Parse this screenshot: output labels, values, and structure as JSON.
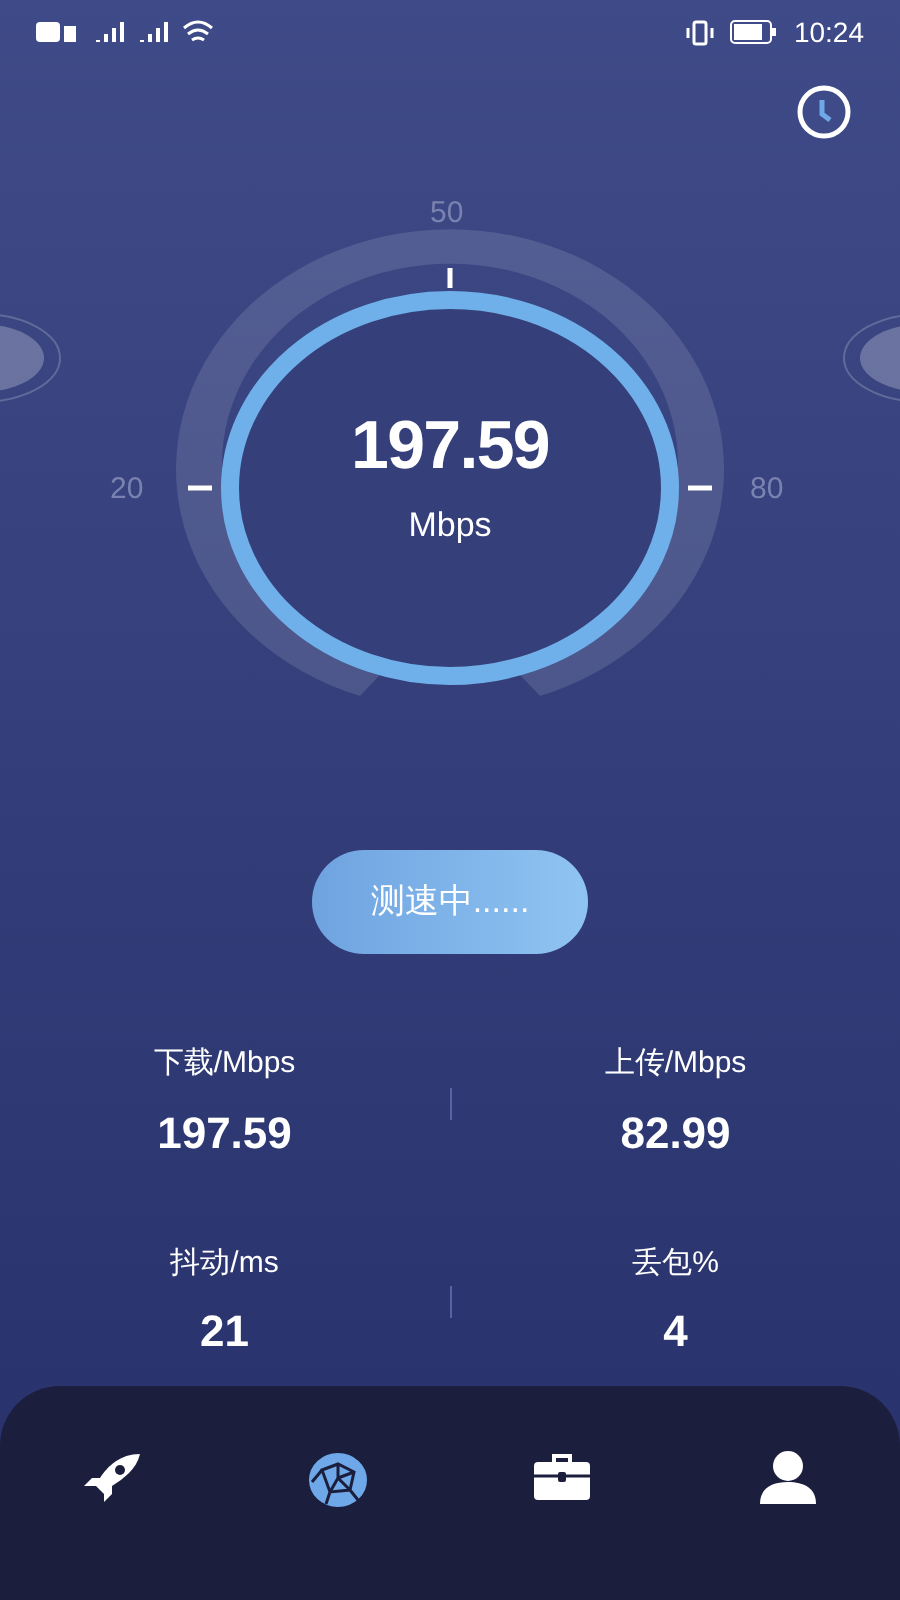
{
  "status_bar": {
    "time": "10:24"
  },
  "gauge": {
    "ticks": [
      "50",
      "20",
      "80"
    ],
    "value": "197.59",
    "unit": "Mbps"
  },
  "button": {
    "label": "测速中......"
  },
  "stats": [
    {
      "label": "下载/Mbps",
      "value": "197.59"
    },
    {
      "label": "上传/Mbps",
      "value": "82.99"
    },
    {
      "label": "抖动/ms",
      "value": "21"
    },
    {
      "label": "丢包%",
      "value": "4"
    }
  ],
  "nav": [
    {
      "kind": "rocket",
      "selected": false
    },
    {
      "kind": "globe",
      "selected": true
    },
    {
      "kind": "briefcase",
      "selected": false
    },
    {
      "kind": "person",
      "selected": false
    }
  ]
}
